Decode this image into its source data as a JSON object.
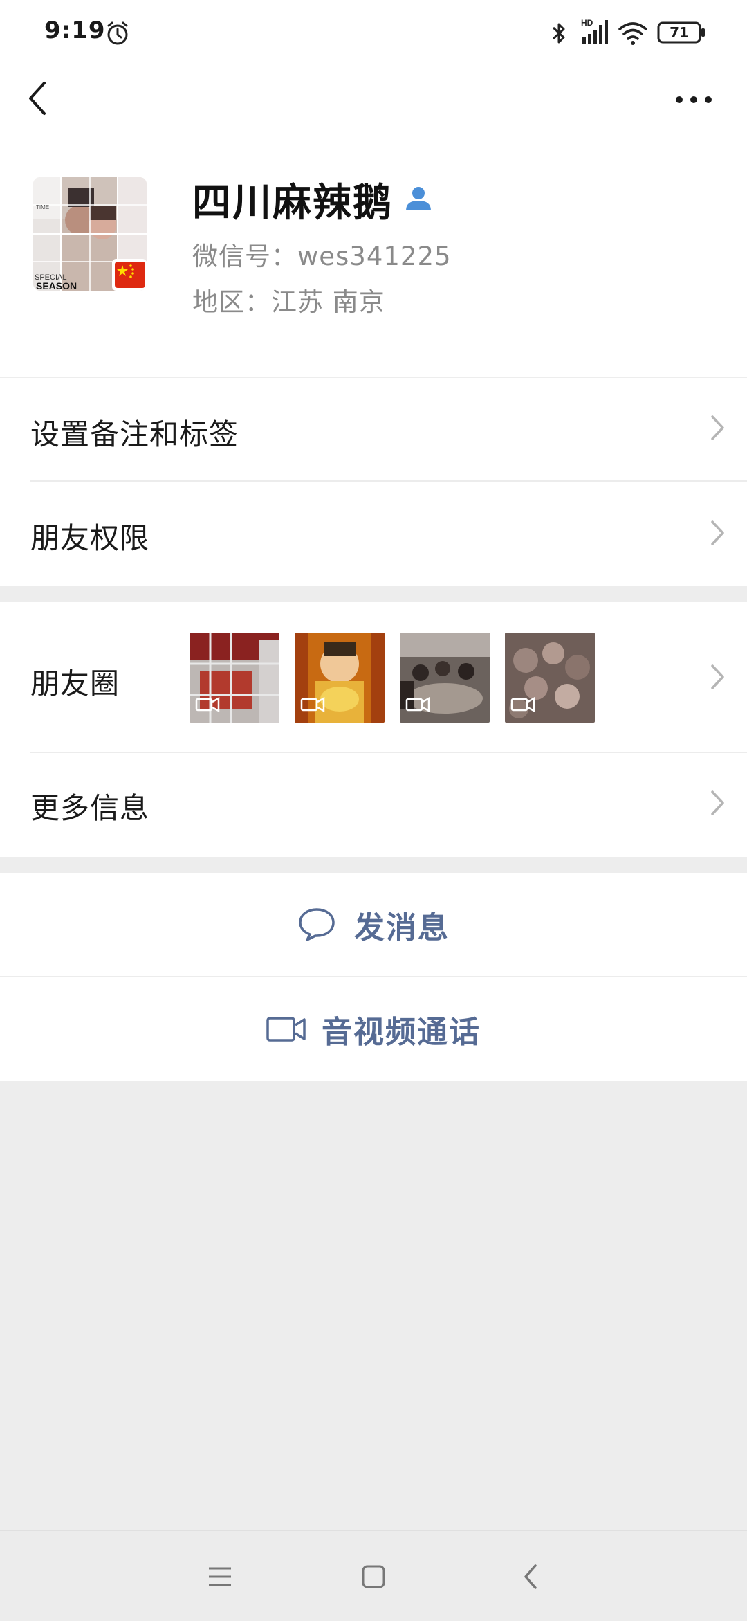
{
  "status_bar": {
    "time": "9:19",
    "battery": "71",
    "network_label": "HD",
    "icons": [
      "alarm-icon",
      "bluetooth-icon",
      "signal-icon",
      "wifi-icon",
      "battery-icon"
    ]
  },
  "navbar": {
    "icons": [
      "back-icon",
      "more-icon"
    ]
  },
  "profile": {
    "name": "四川麻辣鹅",
    "wechat_id": "微信号：wes341225",
    "region": "地区：江苏  南京",
    "verified_icon": "contact-person-icon",
    "avatar_text": {
      "line1": "TIME",
      "line2": "SPECIAL",
      "line3": "SEASON"
    }
  },
  "rows": {
    "remarks": "设置备注和标签",
    "permissions": "朋友权限",
    "moments": "朋友圈",
    "more_info": "更多信息"
  },
  "actions": {
    "message": "发消息",
    "call": "音视频通话"
  },
  "colors": {
    "accent": "#566b94",
    "background": "#ededed",
    "panel": "#ffffff",
    "secondary_text": "#8a8a8a"
  },
  "system_nav": {
    "icons": [
      "menu-icon",
      "home-icon",
      "back-nav-icon"
    ]
  }
}
